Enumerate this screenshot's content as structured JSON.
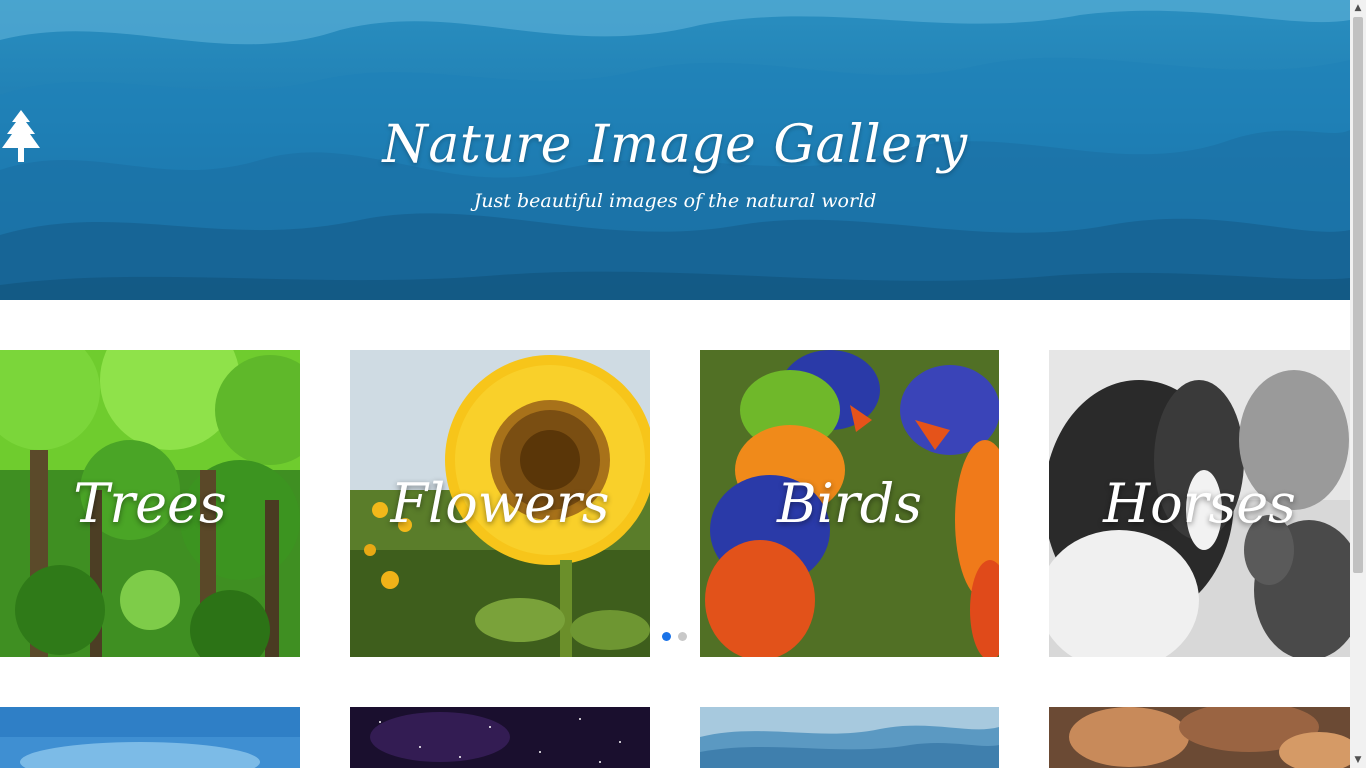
{
  "hero": {
    "title": "Nature Image Gallery",
    "subtitle": "Just beautiful images of the natural world",
    "icon": "tree-icon"
  },
  "gallery": {
    "row1": [
      {
        "label": "Trees"
      },
      {
        "label": "Flowers"
      },
      {
        "label": "Birds"
      },
      {
        "label": "Horses"
      }
    ],
    "row2": [
      {
        "label": "",
        "theme": "sky"
      },
      {
        "label": "",
        "theme": "night-sky"
      },
      {
        "label": "",
        "theme": "mountains"
      },
      {
        "label": "",
        "theme": "canyon"
      }
    ]
  },
  "carousel": {
    "dots": 2,
    "active_index": 0,
    "active_color": "#1a73e8"
  },
  "colors": {
    "hero_blue": "#1f7eb3",
    "text": "#ffffff"
  }
}
